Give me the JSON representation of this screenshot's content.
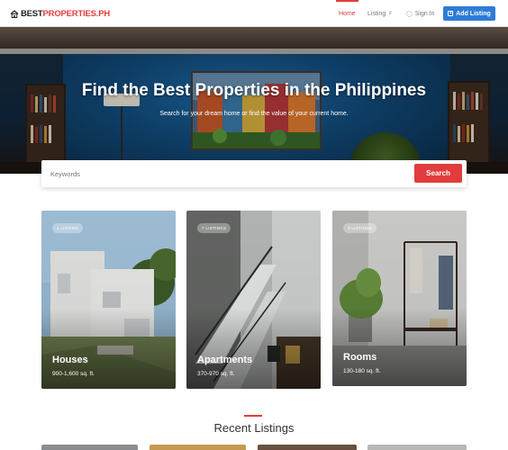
{
  "header": {
    "logo_part1": "BEST",
    "logo_part2": "PROPERTIES.PH",
    "nav": {
      "home": "Home",
      "listing": "Listing",
      "sign_in": "Sign In"
    },
    "add_listing": "Add Listing"
  },
  "hero": {
    "title": "Find the Best Properties in the Philippines",
    "subtitle": "Search for your dream home or find the value of your current home."
  },
  "search": {
    "placeholder": "Keywords",
    "button": "Search"
  },
  "categories": [
    {
      "badge": "1 LISTING",
      "title": "Houses",
      "size": "900-1,600 sq. ft."
    },
    {
      "badge": "7 LISTINGS",
      "title": "Apartments",
      "size": "370-970 sq. ft."
    },
    {
      "badge": "3 LISTINGS",
      "title": "Rooms",
      "size": "130-180 sq. ft."
    }
  ],
  "recent": {
    "title": "Recent Listings"
  },
  "colors": {
    "accent_red": "#e23c3c",
    "accent_blue": "#2f7bd8"
  }
}
